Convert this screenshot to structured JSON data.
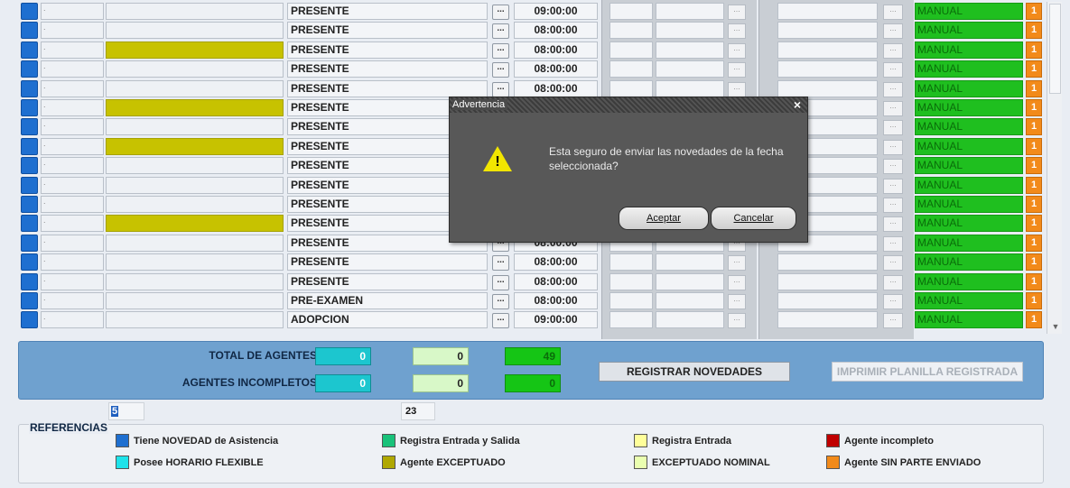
{
  "rows": [
    {
      "c1": ".",
      "yellow": false,
      "status": "PRESENTE",
      "time": "09:00:00",
      "mode": "MANUAL",
      "badge": "1"
    },
    {
      "c1": ".",
      "yellow": false,
      "status": "PRESENTE",
      "time": "08:00:00",
      "mode": "MANUAL",
      "badge": "1"
    },
    {
      "c1": ".",
      "yellow": true,
      "status": "PRESENTE",
      "time": "08:00:00",
      "mode": "MANUAL",
      "badge": "1"
    },
    {
      "c1": ".",
      "yellow": false,
      "status": "PRESENTE",
      "time": "08:00:00",
      "mode": "MANUAL",
      "badge": "1"
    },
    {
      "c1": ".",
      "yellow": false,
      "status": "PRESENTE",
      "time": "08:00:00",
      "mode": "MANUAL",
      "badge": "1"
    },
    {
      "c1": ".",
      "yellow": true,
      "status": "PRESENTE",
      "time": "",
      "mode": "MANUAL",
      "badge": "1"
    },
    {
      "c1": ".",
      "yellow": false,
      "status": "PRESENTE",
      "time": "",
      "mode": "MANUAL",
      "badge": "1"
    },
    {
      "c1": ".",
      "yellow": true,
      "status": "PRESENTE",
      "time": "",
      "mode": "MANUAL",
      "badge": "1"
    },
    {
      "c1": ".",
      "yellow": false,
      "status": "PRESENTE",
      "time": "",
      "mode": "MANUAL",
      "badge": "1"
    },
    {
      "c1": ".",
      "yellow": false,
      "status": "PRESENTE",
      "time": "",
      "mode": "MANUAL",
      "badge": "1"
    },
    {
      "c1": ".",
      "yellow": false,
      "status": "PRESENTE",
      "time": "",
      "mode": "MANUAL",
      "badge": "1"
    },
    {
      "c1": ".",
      "yellow": true,
      "status": "PRESENTE",
      "time": "",
      "mode": "MANUAL",
      "badge": "1"
    },
    {
      "c1": ".",
      "yellow": false,
      "status": "PRESENTE",
      "time": "08:00:00",
      "mode": "MANUAL",
      "badge": "1"
    },
    {
      "c1": ".",
      "yellow": false,
      "status": "PRESENTE",
      "time": "08:00:00",
      "mode": "MANUAL",
      "badge": "1"
    },
    {
      "c1": ".",
      "yellow": false,
      "status": "PRESENTE",
      "time": "08:00:00",
      "mode": "MANUAL",
      "badge": "1"
    },
    {
      "c1": ".",
      "yellow": false,
      "status": "PRE-EXAMEN",
      "time": "08:00:00",
      "mode": "MANUAL",
      "badge": "1"
    },
    {
      "c1": ".",
      "yellow": false,
      "status": "ADOPCION",
      "time": "09:00:00",
      "mode": "MANUAL",
      "badge": "1"
    }
  ],
  "grid": {
    "ellipsis": "..."
  },
  "totals": {
    "total_label": "TOTAL DE AGENTES",
    "incomplete_label": "AGENTES INCOMPLETOS",
    "total_cyan": "0",
    "total_light": "0",
    "total_green": "49",
    "inc_cyan": "0",
    "inc_light": "0",
    "inc_green": "0",
    "register_button": "REGISTRAR NOVEDADES",
    "print_button": "IMPRIMIR PLANILLA REGISTRADA"
  },
  "counters": {
    "left": "5",
    "right": "23"
  },
  "references": {
    "title": "REFERENCIAS",
    "items": [
      {
        "label": "Tiene NOVEDAD de Asistencia",
        "color": "#1e6fd0"
      },
      {
        "label": "Posee HORARIO FLEXIBLE",
        "color": "#1ee3ea"
      },
      {
        "label": "Registra Entrada y Salida",
        "color": "#19c27a"
      },
      {
        "label": "Agente EXCEPTUADO",
        "color": "#b0a800"
      },
      {
        "label": "Registra Entrada",
        "color": "#ffff9a"
      },
      {
        "label": "EXCEPTUADO NOMINAL",
        "color": "#eaffb0"
      },
      {
        "label": "Agente incompleto",
        "color": "#c00000"
      },
      {
        "label": "Agente SIN PARTE ENVIADO",
        "color": "#f28a1a"
      }
    ]
  },
  "dialog": {
    "title": "Advertencia",
    "close": "×",
    "message": "Esta seguro de enviar las novedades de la fecha seleccionada?",
    "accept": "Aceptar",
    "cancel": "Cancelar"
  }
}
